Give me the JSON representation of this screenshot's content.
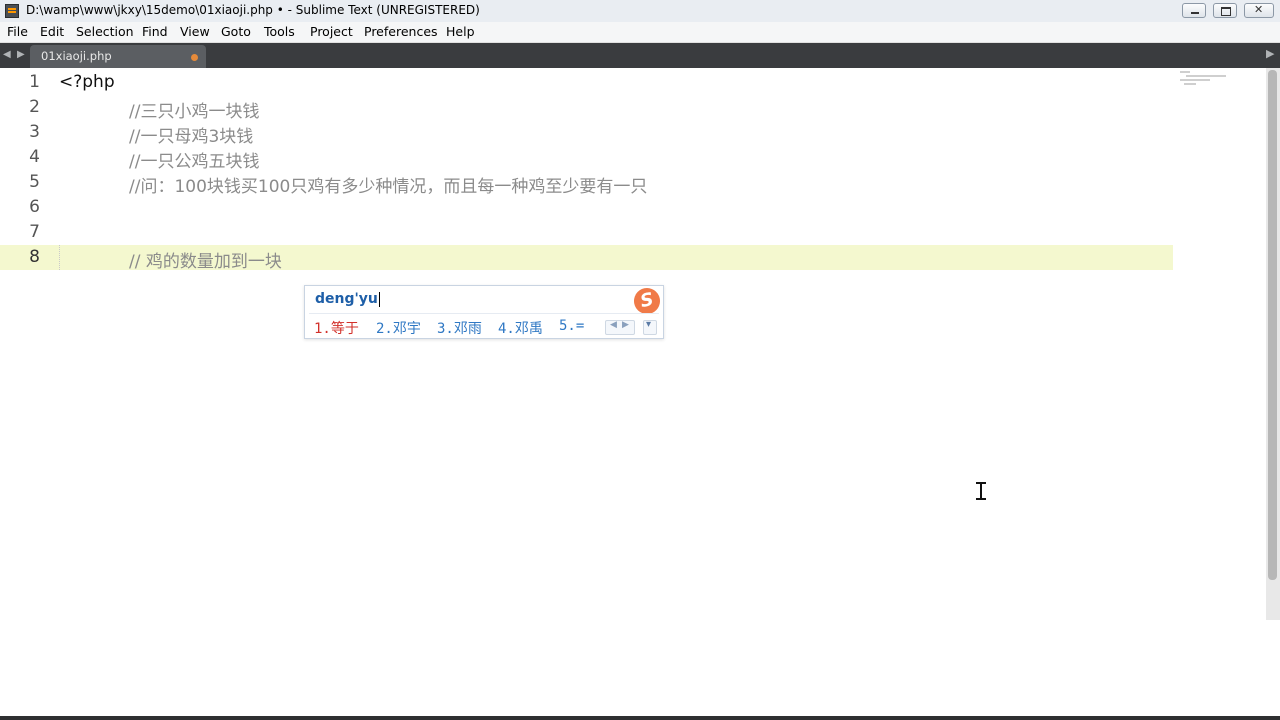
{
  "window": {
    "title": "D:\\wamp\\www\\jkxy\\15demo\\01xiaoji.php • - Sublime Text (UNREGISTERED)"
  },
  "menu": [
    "File",
    "Edit",
    "Selection",
    "Find",
    "View",
    "Goto",
    "Tools",
    "Project",
    "Preferences",
    "Help"
  ],
  "tabs": [
    {
      "label": "01xiaoji.php",
      "modified": true
    }
  ],
  "editor": {
    "current_line": 8,
    "line_numbers": [
      "1",
      "2",
      "3",
      "4",
      "5",
      "6",
      "7",
      "8"
    ],
    "lines": [
      "<?php",
      "//三只小鸡一块钱",
      "//一只母鸡3块钱",
      "//一只公鸡五块钱",
      "//问：100块钱买100只鸡有多少种情况，而且每一种鸡至少要有一只",
      "",
      "",
      "// 鸡的数量加到一块"
    ]
  },
  "ime": {
    "input": "deng'yu",
    "candidates": [
      "1.等于",
      "2.邓宇",
      "3.邓雨",
      "4.邓禹",
      "5.="
    ],
    "logo": "S"
  },
  "colors": {
    "tabbar_bg": "#3a3c3f",
    "tab_bg": "#5b5e62",
    "modified_dot": "#e58a3a",
    "line_highlight": "#f4f8cf",
    "comment": "#8b8b8b",
    "ime_text": "#1e5fa8",
    "ime_active": "#d2302a",
    "ime_logo": "#f07a48"
  },
  "icons": {
    "app": "sublime-text-icon",
    "minimize": "minimize-icon",
    "maximize": "maximize-icon",
    "close": "close-icon",
    "nav_back": "triangle-left-icon",
    "nav_forward": "triangle-right-icon",
    "tab_overflow": "tab-list-icon",
    "ime_logo": "sogou-ime-icon",
    "pager": "page-arrows-icon",
    "expand": "chevron-down-icon",
    "cursor": "ibeam-cursor-icon"
  }
}
